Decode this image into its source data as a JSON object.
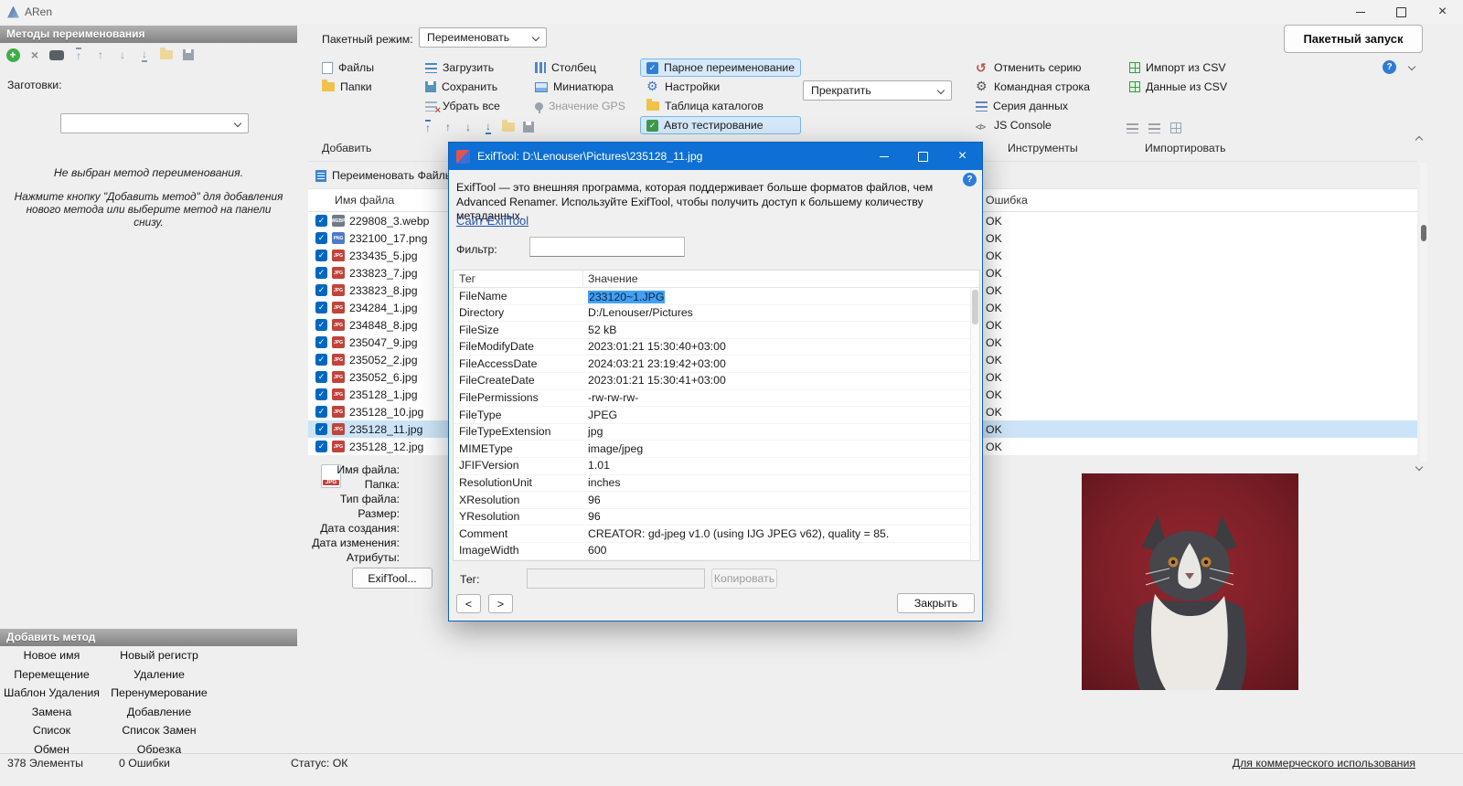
{
  "titlebar": {
    "app_name": "ARen"
  },
  "topbar": {
    "batch_mode_label": "Пакетный режим:",
    "batch_mode_value": "Переименовать",
    "batch_run_label": "Пакетный запуск"
  },
  "ribbon": {
    "add_group": {
      "files": "Файлы",
      "folders": "Папки"
    },
    "list_group": {
      "load": "Загрузить",
      "save": "Сохранить",
      "clear_all": "Убрать все"
    },
    "view_group": {
      "column": "Столбец",
      "thumbnail": "Миниатюра",
      "gps_value": "Значение GPS"
    },
    "tools_group": {
      "pair_rename": "Парное переименование",
      "settings": "Настройки",
      "dir_table": "Таблица каталогов",
      "auto_test": "Авто тестирование"
    },
    "stop_dropdown": "Прекратить",
    "utils_group": {
      "undo_batch": "Отменить серию",
      "command_line": "Командная строка",
      "data_series": "Серия данных",
      "js_console": "JS Console"
    },
    "import_group": {
      "import_csv": "Импорт из CSV",
      "data_csv": "Данные из CSV"
    },
    "captions": {
      "add": "Добавить",
      "tools": "Инструменты",
      "import": "Импортировать"
    }
  },
  "methods_panel": {
    "header": "Методы переименования",
    "presets_label": "Заготовки:",
    "empty_title": "Не выбран метод переименования.",
    "empty_hint": "Нажмите кнопку \"Добавить метод\" для добавления нового метода или выберите метод на панели снизу."
  },
  "add_method_panel": {
    "header": "Добавить метод",
    "rows": [
      {
        "left": "Новое имя",
        "right": "Новый регистр"
      },
      {
        "left": "Перемещение",
        "right": "Удаление"
      },
      {
        "left": "Шаблон Удаления",
        "right": "Перенумерование"
      },
      {
        "left": "Замена",
        "right": "Добавление"
      },
      {
        "left": "Список",
        "right": "Список Замен"
      },
      {
        "left": "Обмен",
        "right": "Обрезка"
      }
    ]
  },
  "file_list": {
    "tab_label": "Переименовать Файлы",
    "filename_header": "Имя файла",
    "error_header": "Ошибка",
    "files": [
      {
        "name": "229808_3.webp",
        "ext": "WEBP",
        "status": "OK"
      },
      {
        "name": "232100_17.png",
        "ext": "PNG",
        "status": "OK"
      },
      {
        "name": "233435_5.jpg",
        "ext": "JPG",
        "status": "OK"
      },
      {
        "name": "233823_7.jpg",
        "ext": "JPG",
        "status": "OK"
      },
      {
        "name": "233823_8.jpg",
        "ext": "JPG",
        "status": "OK"
      },
      {
        "name": "234284_1.jpg",
        "ext": "JPG",
        "status": "OK"
      },
      {
        "name": "234848_8.jpg",
        "ext": "JPG",
        "status": "OK"
      },
      {
        "name": "235047_9.jpg",
        "ext": "JPG",
        "status": "OK"
      },
      {
        "name": "235052_2.jpg",
        "ext": "JPG",
        "status": "OK"
      },
      {
        "name": "235052_6.jpg",
        "ext": "JPG",
        "status": "OK"
      },
      {
        "name": "235128_1.jpg",
        "ext": "JPG",
        "status": "OK"
      },
      {
        "name": "235128_10.jpg",
        "ext": "JPG",
        "status": "OK"
      },
      {
        "name": "235128_11.jpg",
        "ext": "JPG",
        "status": "OK"
      },
      {
        "name": "235128_12.jpg",
        "ext": "JPG",
        "status": "OK"
      }
    ]
  },
  "info_panel": {
    "labels": {
      "filename": "Имя файла:",
      "folder": "Папка:",
      "filetype": "Тип файла:",
      "size": "Размер:",
      "created": "Дата создания:",
      "modified": "Дата изменения:",
      "attributes": "Атрибуты:"
    },
    "exiftool_button": "ExifTool..."
  },
  "exif_dialog": {
    "title": "ExifTool: D:\\Lenouser\\Pictures\\235128_11.jpg",
    "description": "ExifTool — это внешняя программа, которая поддерживает больше форматов файлов, чем Advanced Renamer. Используйте ExifTool, чтобы получить доступ к большему количеству метаданных.",
    "website_link": "Сайт ExifTool",
    "filter_label": "Фильтр:",
    "tag_header": "Тег",
    "value_header": "Значение",
    "rows": [
      {
        "tag": "FileName",
        "value": "233120~1.JPG"
      },
      {
        "tag": "Directory",
        "value": "D:/Lenouser/Pictures"
      },
      {
        "tag": "FileSize",
        "value": "52 kB"
      },
      {
        "tag": "FileModifyDate",
        "value": "2023:01:21 15:30:40+03:00"
      },
      {
        "tag": "FileAccessDate",
        "value": "2024:03:21 23:19:42+03:00"
      },
      {
        "tag": "FileCreateDate",
        "value": "2023:01:21 15:30:41+03:00"
      },
      {
        "tag": "FilePermissions",
        "value": "-rw-rw-rw-"
      },
      {
        "tag": "FileType",
        "value": "JPEG"
      },
      {
        "tag": "FileTypeExtension",
        "value": "jpg"
      },
      {
        "tag": "MIMEType",
        "value": "image/jpeg"
      },
      {
        "tag": "JFIFVersion",
        "value": "1.01"
      },
      {
        "tag": "ResolutionUnit",
        "value": "inches"
      },
      {
        "tag": "XResolution",
        "value": "96"
      },
      {
        "tag": "YResolution",
        "value": "96"
      },
      {
        "tag": "Comment",
        "value": "CREATOR: gd-jpeg v1.0 (using IJG JPEG v62), quality = 85."
      },
      {
        "tag": "ImageWidth",
        "value": "600"
      }
    ],
    "tag_label": "Тег:",
    "copy_button": "Копировать",
    "prev_button": "<",
    "next_button": ">",
    "close_button": "Закрыть"
  },
  "statusbar": {
    "items_count": "378 Элементы",
    "errors_count": "0 Ошибки",
    "status": "Статус: ОК",
    "license_link": "Для коммерческого использования"
  }
}
